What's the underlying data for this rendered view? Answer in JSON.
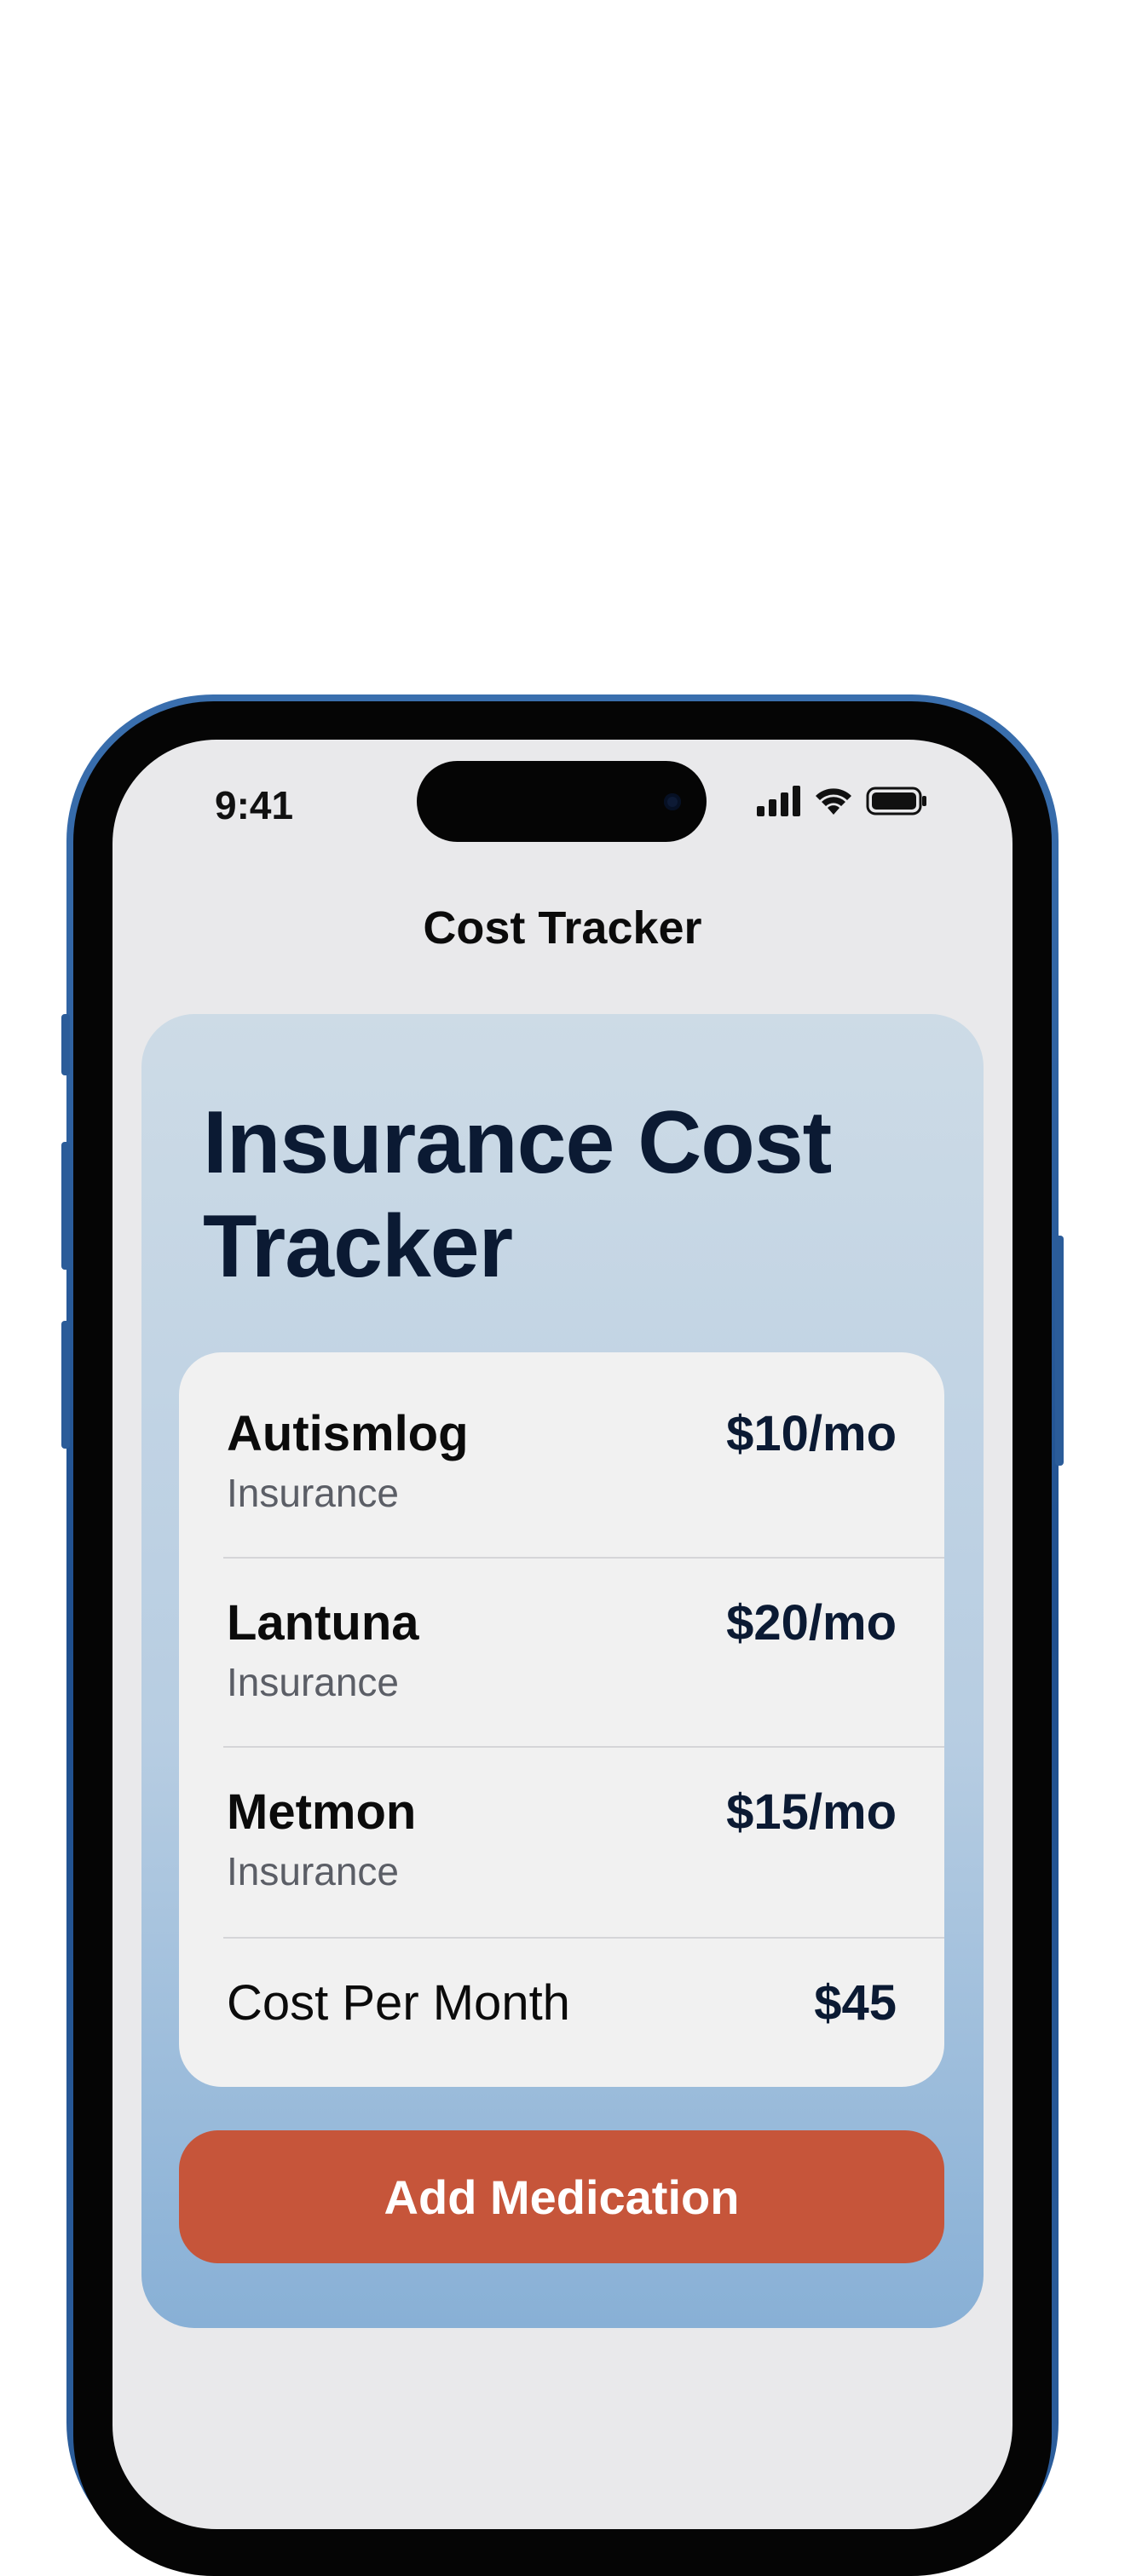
{
  "status_bar": {
    "time": "9:41",
    "icons": [
      "cellular-signal-icon",
      "wifi-icon",
      "battery-icon"
    ]
  },
  "nav": {
    "title": "Cost Tracker"
  },
  "hero": {
    "title": "Insurance Cost Tracker"
  },
  "medications": [
    {
      "name": "Autismlog",
      "subtitle": "Insurance",
      "price": "$10/mo"
    },
    {
      "name": "Lantuna",
      "subtitle": "Insurance",
      "price": "$20/mo"
    },
    {
      "name": "Metmon",
      "subtitle": "Insurance",
      "price": "$15/mo"
    }
  ],
  "total": {
    "label": "Cost Per Month",
    "value": "$45"
  },
  "actions": {
    "add_label": "Add Medication"
  },
  "colors": {
    "accent_button": "#c6553a",
    "title_text": "#0b1a33",
    "hero_gradient_top": "#cddbe6",
    "hero_gradient_bottom": "#88b0d6",
    "phone_frame": "#2d5f9d"
  }
}
